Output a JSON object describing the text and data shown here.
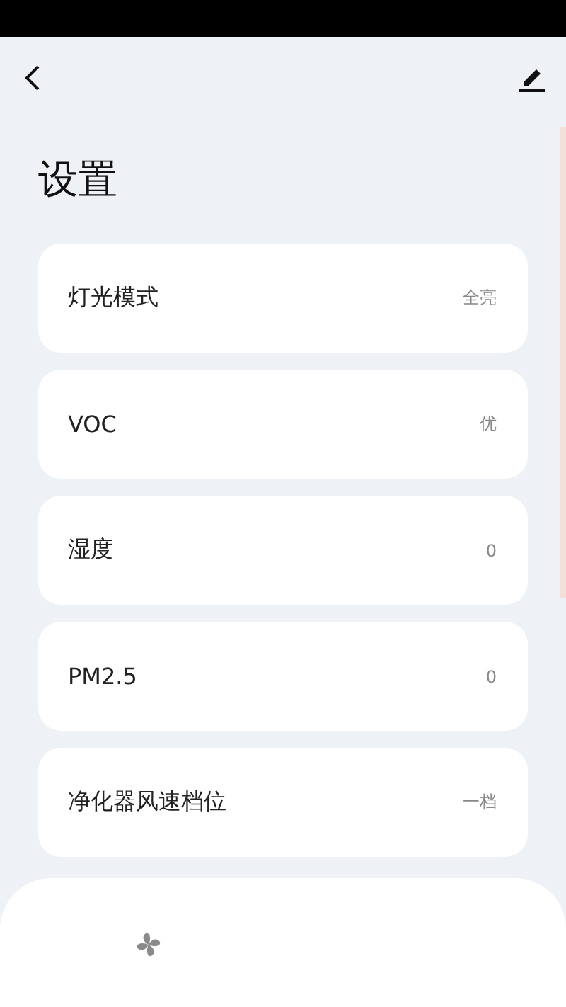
{
  "title": "设置",
  "items": [
    {
      "label": "灯光模式",
      "value": "全亮"
    },
    {
      "label": "VOC",
      "value": "优"
    },
    {
      "label": "湿度",
      "value": "0"
    },
    {
      "label": "PM2.5",
      "value": "0"
    },
    {
      "label": "净化器风速档位",
      "value": "一档"
    }
  ]
}
